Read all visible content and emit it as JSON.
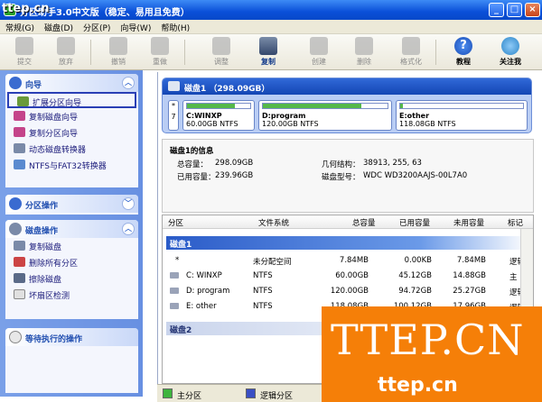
{
  "window": {
    "title": "分区助手3.0中文版（稳定、易用且免费）",
    "logo": "ttep.cn"
  },
  "menu": [
    "常规(G)",
    "磁盘(D)",
    "分区(P)",
    "向导(W)",
    "帮助(H)"
  ],
  "toolbar": {
    "submit": "提交",
    "discard": "放弃",
    "undo": "撤销",
    "redo": "重做",
    "adjust": "调整",
    "copy": "复制",
    "create": "创建",
    "delete": "删除",
    "format": "格式化",
    "tutorial": "教程",
    "follow": "关注我"
  },
  "left": {
    "wizard": {
      "title": "向导",
      "items": [
        "扩展分区向导",
        "复制磁盘向导",
        "复制分区向导",
        "动态磁盘转换器",
        "NTFS与FAT32转换器"
      ]
    },
    "partition_ops": {
      "title": "分区操作"
    },
    "disk_ops": {
      "title": "磁盘操作",
      "items": [
        "复制磁盘",
        "删除所有分区",
        "擦除磁盘",
        "坏扇区检测"
      ]
    },
    "pending": {
      "title": "等待执行的操作"
    }
  },
  "diskmap": {
    "header": "磁盘1 （298.09GB）",
    "unalloc": {
      "top": "*",
      "bottom": "7"
    },
    "parts": [
      {
        "name": "C:WINXP",
        "info": "60.00GB NTFS",
        "used": 0.75
      },
      {
        "name": "D:program",
        "info": "120.00GB NTFS",
        "used": 0.79
      },
      {
        "name": "E:other",
        "info": "118.08GB NTFS",
        "used": 0.02
      }
    ]
  },
  "info": {
    "title": "磁盘1的信息",
    "total_label": "总容量：",
    "total": "298.09GB",
    "used_label": "已用容量：",
    "used": "239.96GB",
    "geo_label": "几何结构：",
    "geo": "38913, 255, 63",
    "model_label": "磁盘型号：",
    "model": "WDC WD3200AAJS-00L7A0"
  },
  "table": {
    "headers": [
      "分区",
      "文件系统",
      "总容量",
      "已用容量",
      "未用容量",
      "标记"
    ],
    "disk1": "磁盘1",
    "disk2": "磁盘2",
    "rows": [
      {
        "name": "*",
        "fs": "未分配空间",
        "total": "7.84MB",
        "used": "0.00KB",
        "free": "7.84MB",
        "flag": "逻辑"
      },
      {
        "name": "C: WINXP",
        "fs": "NTFS",
        "total": "60.00GB",
        "used": "45.12GB",
        "free": "14.88GB",
        "flag": "主"
      },
      {
        "name": "D: program",
        "fs": "NTFS",
        "total": "120.00GB",
        "used": "94.72GB",
        "free": "25.27GB",
        "flag": "逻辑"
      },
      {
        "name": "E: other",
        "fs": "NTFS",
        "total": "118.08GB",
        "used": "100.12GB",
        "free": "17.96GB",
        "flag": "逻辑"
      }
    ]
  },
  "status": {
    "primary": "主分区",
    "logical": "逻辑分区"
  },
  "watermark": {
    "big": "TTEP.CN",
    "small": "ttep.cn"
  },
  "colors": {
    "primary": "#3db43d",
    "logical": "#3a4fc4",
    "used_fill": "#55b84a",
    "accent": "#f57f08"
  }
}
